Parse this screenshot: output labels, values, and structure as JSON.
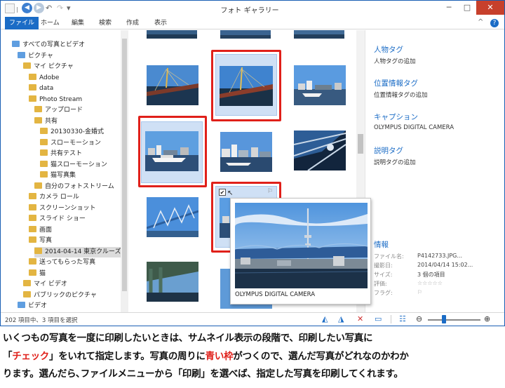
{
  "window": {
    "title": "フォト ギャラリー",
    "quick_access": [
      "◀",
      "▶",
      "↶",
      "▾"
    ],
    "controls": {
      "minimize": "─",
      "maximize": "□",
      "close": "✕"
    }
  },
  "ribbon": {
    "tabs": [
      "ファイル",
      "ホーム",
      "編集",
      "検索",
      "作成",
      "表示"
    ],
    "help": "?",
    "collapse": "^"
  },
  "nav": {
    "items": [
      {
        "label": "すべての写真とビデオ",
        "indent": 0,
        "icon": "pic"
      },
      {
        "label": "ピクチャ",
        "indent": 1,
        "icon": "pic"
      },
      {
        "label": "マイ ピクチャ",
        "indent": 2,
        "icon": "folder"
      },
      {
        "label": "Adobe",
        "indent": 3,
        "icon": "folder"
      },
      {
        "label": "data",
        "indent": 3,
        "icon": "folder"
      },
      {
        "label": "Photo Stream",
        "indent": 3,
        "icon": "folder"
      },
      {
        "label": "アップロード",
        "indent": 4,
        "icon": "folder"
      },
      {
        "label": "共有",
        "indent": 4,
        "icon": "folder"
      },
      {
        "label": "20130330-金婚式",
        "indent": 5,
        "icon": "folder"
      },
      {
        "label": "スローモーション",
        "indent": 5,
        "icon": "folder"
      },
      {
        "label": "共有テスト",
        "indent": 5,
        "icon": "folder"
      },
      {
        "label": "猫スローモーション",
        "indent": 5,
        "icon": "folder"
      },
      {
        "label": "猫写真集",
        "indent": 5,
        "icon": "folder"
      },
      {
        "label": "自分のフォトストリーム",
        "indent": 4,
        "icon": "folder"
      },
      {
        "label": "カメラ ロール",
        "indent": 3,
        "icon": "folder"
      },
      {
        "label": "スクリーンショット",
        "indent": 3,
        "icon": "folder"
      },
      {
        "label": "スライド ショー",
        "indent": 3,
        "icon": "folder"
      },
      {
        "label": "画面",
        "indent": 3,
        "icon": "folder"
      },
      {
        "label": "写真",
        "indent": 3,
        "icon": "folder"
      },
      {
        "label": "2014-04-14 東京クルーズ",
        "indent": 4,
        "icon": "folder",
        "selected": true
      },
      {
        "label": "送ってもらった写真",
        "indent": 3,
        "icon": "folder"
      },
      {
        "label": "猫",
        "indent": 3,
        "icon": "folder"
      },
      {
        "label": "マイ ビデオ",
        "indent": 2,
        "icon": "folder"
      },
      {
        "label": "パブリックのピクチャ",
        "indent": 2,
        "icon": "folder"
      },
      {
        "label": "ビデオ",
        "indent": 1,
        "icon": "pic"
      }
    ]
  },
  "details": {
    "people_tag_heading": "人物タグ",
    "people_tag_add": "人物タグの追加",
    "geo_tag_heading": "位置情報タグ",
    "geo_tag_add": "位置情報タグの追加",
    "caption_heading": "キャプション",
    "caption_value": "OLYMPUS DIGITAL CAMERA",
    "desc_tag_heading": "説明タグ",
    "desc_tag_add": "説明タグの追加",
    "info_heading": "情報",
    "info": [
      {
        "label": "ファイル名:",
        "value": "P4142733.JPG..."
      },
      {
        "label": "撮影日:",
        "value": "2014/04/14  15:02..."
      },
      {
        "label": "サイズ:",
        "value": "3 個の項目"
      },
      {
        "label": "評価:",
        "value": "☆☆☆☆☆"
      },
      {
        "label": "フラグ:",
        "value": "⚐"
      }
    ]
  },
  "popup": {
    "caption": "OLYMPUS DIGITAL CAMERA"
  },
  "status": {
    "text": "202 項目中、3 項目を選択",
    "icons": [
      "rotate-left-icon",
      "rotate-right-icon",
      "delete-icon",
      "slideshow-icon",
      "details-icon",
      "zoom-out-icon",
      "zoom-in-icon"
    ],
    "zoom_level": 0.27
  },
  "body_caption": {
    "line1": "いくつもの写真を一度に印刷したいときは、サムネイル表示の段階で、印刷したい写真に",
    "line2_a": "「",
    "line2_red1": "チェック",
    "line2_b": "」をいれて指定します。写真の周りに",
    "line2_red2": "青い枠",
    "line2_c": "がつくので、選んだ写真がどれなのかわか",
    "line3": "ります。選んだら､ファイルメニューから「印刷」を選べば、指定した写真を印刷してくれます。"
  },
  "colors": {
    "accent": "#1b6cc6",
    "highlight_red": "#e0201a",
    "selection_bg": "#cfe0f5"
  }
}
